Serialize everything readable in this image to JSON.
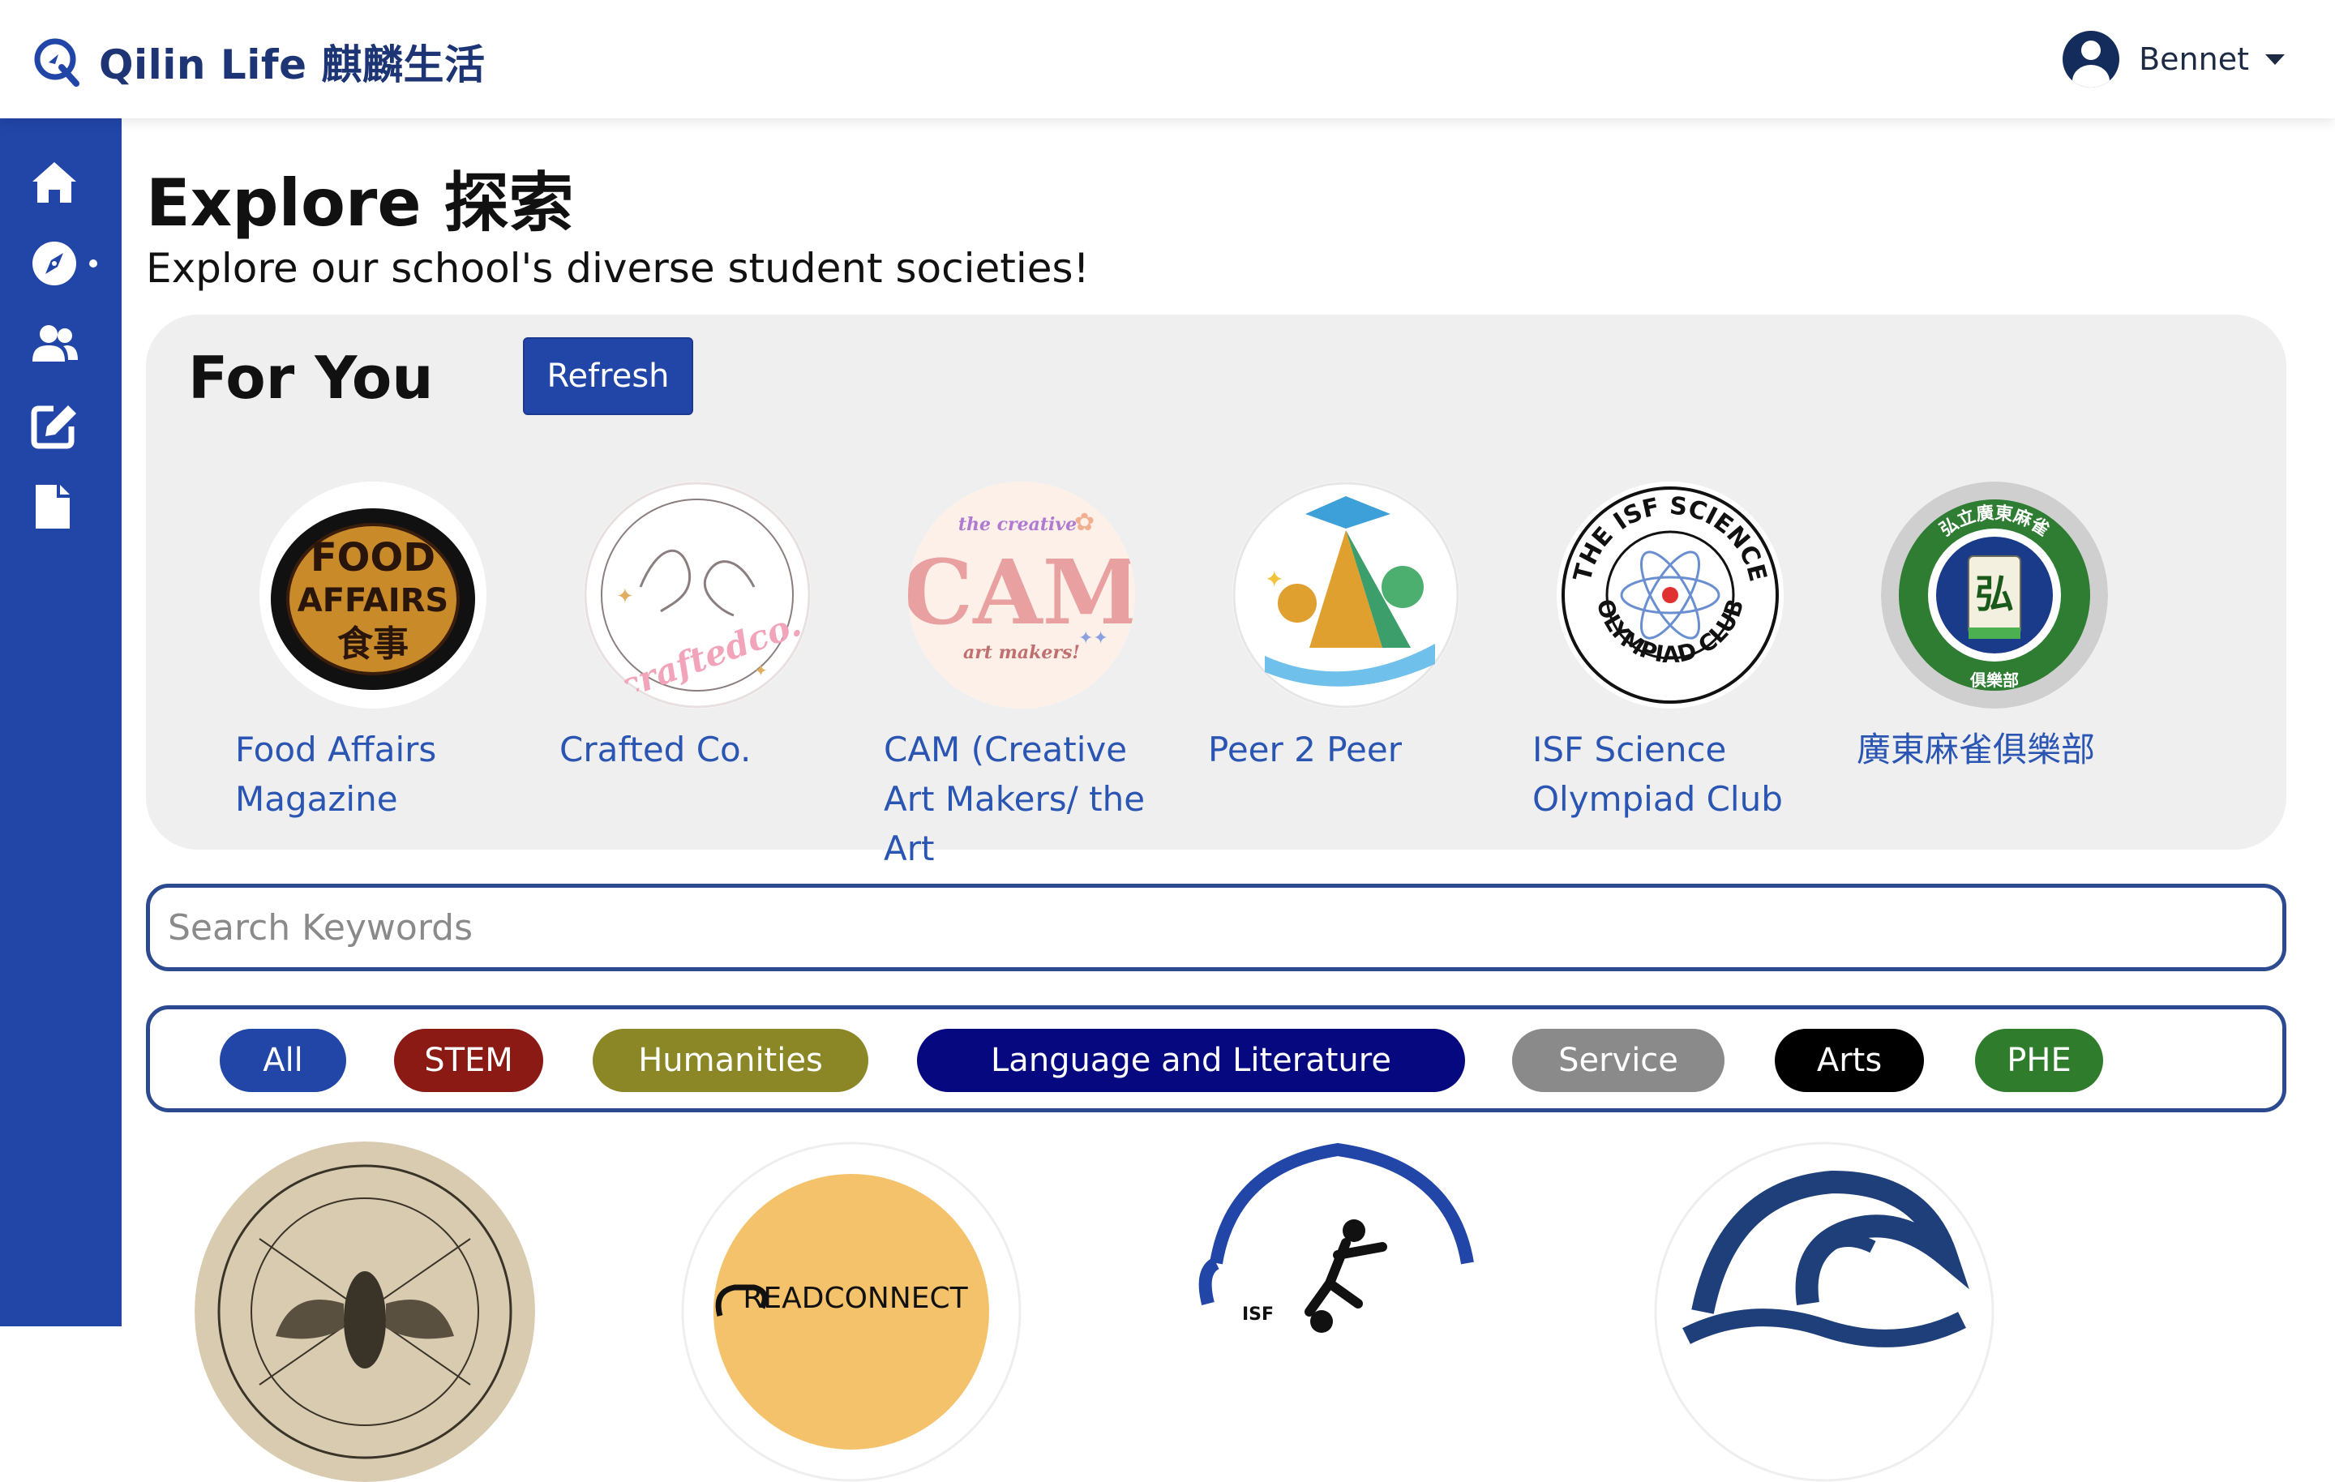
{
  "header": {
    "brand": "Qilin Life 麒麟生活",
    "user_name": "Bennet"
  },
  "sidebar": {
    "items": [
      {
        "name": "home",
        "icon": "home-icon"
      },
      {
        "name": "explore",
        "icon": "compass-icon",
        "active": true
      },
      {
        "name": "societies",
        "icon": "users-icon"
      },
      {
        "name": "edit",
        "icon": "edit-icon"
      },
      {
        "name": "documents",
        "icon": "file-icon"
      }
    ]
  },
  "main": {
    "title": "Explore 探索",
    "subtitle": "Explore our school's diverse student societies!"
  },
  "for_you": {
    "title": "For You",
    "refresh_label": "Refresh",
    "items": [
      {
        "name": "Food Affairs Magazine",
        "logo_text_1": "FOOD",
        "logo_text_2": "AFFAIRS",
        "logo_text_3": "食事"
      },
      {
        "name": "Crafted Co.",
        "logo_text_1": "craftedco."
      },
      {
        "name": "CAM (Creative Art Makers/ the Art",
        "logo_text_1": "the creative",
        "logo_text_2": "CAM",
        "logo_text_3": "art makers!"
      },
      {
        "name": "Peer 2 Peer"
      },
      {
        "name": "ISF Science Olympiad Club",
        "logo_text_1": "THE ISF SCIENCE",
        "logo_text_2": "OLYMPIAD CLUB"
      },
      {
        "name": "廣東麻雀俱樂部",
        "logo_text_1": "弘立廣東麻雀",
        "logo_text_2": "俱樂部",
        "logo_text_3": "弘"
      }
    ]
  },
  "search": {
    "placeholder": "Search Keywords",
    "value": ""
  },
  "filters": [
    {
      "label": "All",
      "color": "#2146a8"
    },
    {
      "label": "STEM",
      "color": "#8b1a14"
    },
    {
      "label": "Humanities",
      "color": "#8b8727"
    },
    {
      "label": "Language and Literature",
      "color": "#05087f"
    },
    {
      "label": "Service",
      "color": "#8a8a8a"
    },
    {
      "label": "Arts",
      "color": "#000000"
    },
    {
      "label": "PHE",
      "color": "#2f7d2c"
    }
  ],
  "grid_partial": {
    "read_connect_text": "READCONNECT",
    "isf_text": "ISF"
  },
  "colors": {
    "brand_blue": "#2146a8",
    "navy": "#1d3575",
    "link_blue": "#2a55b3",
    "panel_gray": "#efefef"
  }
}
